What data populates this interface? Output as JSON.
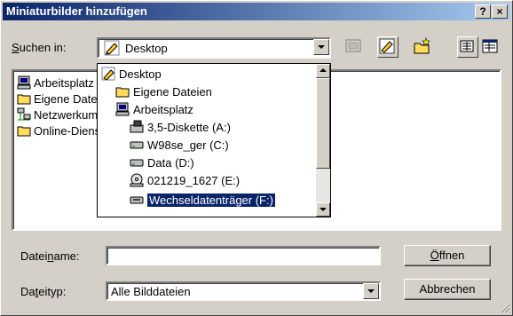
{
  "window": {
    "title": "Miniaturbilder hinzufügen",
    "help_label": "?",
    "close_label": "×"
  },
  "lookin": {
    "label_prefix": "S",
    "label_rest": "uchen in:",
    "value": "Desktop"
  },
  "file_list": [
    {
      "label": "Arbeitsplatz",
      "icon": "computer-icon"
    },
    {
      "label": "Eigene Dateien",
      "icon": "folder-icon"
    },
    {
      "label": "Netzwerkumgebung",
      "icon": "network-icon"
    },
    {
      "label": "Online-Dienste",
      "icon": "folder-icon"
    }
  ],
  "dropdown": [
    {
      "label": "Desktop",
      "icon": "desktop-icon",
      "level": 0
    },
    {
      "label": "Eigene Dateien",
      "icon": "folder-icon",
      "level": 1
    },
    {
      "label": "Arbeitsplatz",
      "icon": "computer-icon",
      "level": 1
    },
    {
      "label": "3,5-Diskette (A:)",
      "icon": "floppy-icon",
      "level": 2
    },
    {
      "label": "W98se_ger (C:)",
      "icon": "harddisk-icon",
      "level": 2
    },
    {
      "label": "Data (D:)",
      "icon": "harddisk-icon",
      "level": 2
    },
    {
      "label": "021219_1627 (E:)",
      "icon": "cdrom-icon",
      "level": 2
    },
    {
      "label": "Wechseldatenträger (F:)",
      "icon": "removable-icon",
      "level": 2,
      "selected": true
    }
  ],
  "filename": {
    "label_a": "Datei",
    "label_u": "n",
    "label_b": "ame:",
    "value": ""
  },
  "filetype": {
    "label_a": "Da",
    "label_u": "t",
    "label_b": "eityp:",
    "value": "Alle Bilddateien"
  },
  "buttons": {
    "open_u": "Ö",
    "open_rest": "ffnen",
    "cancel": "Abbrechen"
  }
}
